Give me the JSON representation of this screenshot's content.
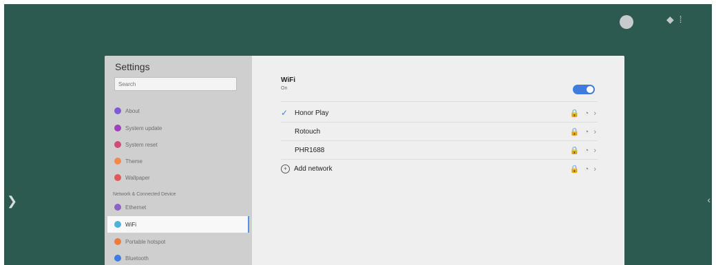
{
  "sidebar": {
    "title": "Settings",
    "search_placeholder": "Search",
    "items_general": [
      {
        "label": "About",
        "color": "#7e5ad7"
      },
      {
        "label": "System update",
        "color": "#a23fbe"
      },
      {
        "label": "System reset",
        "color": "#d14a7a"
      },
      {
        "label": "Theme",
        "color": "#f08a4b"
      },
      {
        "label": "Wallpaper",
        "color": "#e3575b"
      }
    ],
    "section_header": "Network & Connected Device",
    "items_network": [
      {
        "label": "Ethernet",
        "color": "#8c62c7"
      },
      {
        "label": "WiFi",
        "color": "#4cb3de",
        "active": true
      },
      {
        "label": "Portable hotspot",
        "color": "#f07a3b"
      },
      {
        "label": "Bluetooth",
        "color": "#3f7be0"
      }
    ]
  },
  "content": {
    "wifi_title": "WiFi",
    "wifi_status": "On",
    "networks": [
      {
        "label": "Honor Play",
        "checked": true
      },
      {
        "label": "Rotouch",
        "checked": false
      },
      {
        "label": "PHR1688",
        "checked": false
      }
    ],
    "add_network_label": "Add network",
    "row_icons": "🔒 ◔ ›"
  }
}
